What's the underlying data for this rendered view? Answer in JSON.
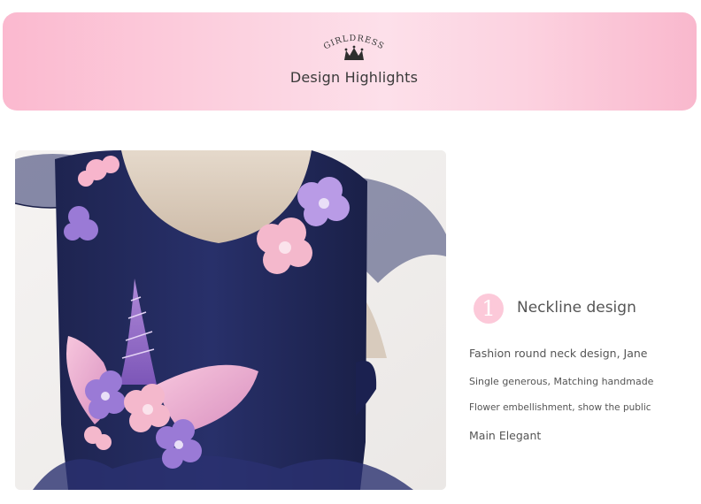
{
  "header": {
    "logo_text": "GIRLDRESS",
    "section_title": "Design Highlights",
    "accent_color": "#fbb9cf"
  },
  "product_image": {
    "icon": "dress-photo"
  },
  "feature": {
    "number": "1",
    "title": "Neckline design",
    "description_lines": [
      "Fashion round neck design, Jane",
      "Single generous, Matching handmade",
      "Flower embellishment, show the public",
      "Main Elegant"
    ]
  }
}
